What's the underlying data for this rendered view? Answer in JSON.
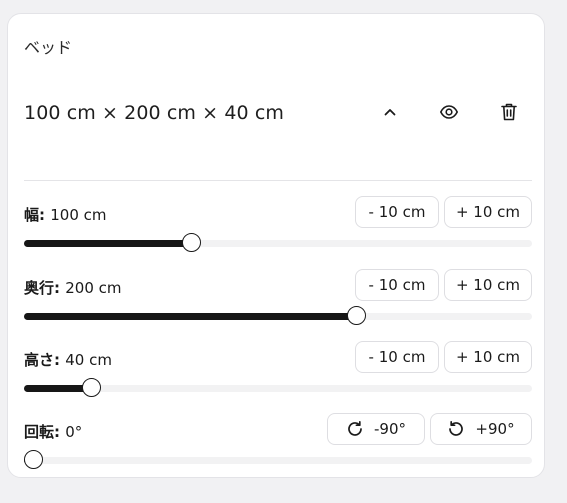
{
  "panel": {
    "title": "ベッド",
    "dimensions_text": "100 cm × 200 cm × 40 cm"
  },
  "header_icons": [
    "chevron-up-icon",
    "eye-icon",
    "trash-icon"
  ],
  "controls": {
    "width": {
      "label": "幅:",
      "value_text": "100 cm",
      "minus_label": "- 10 cm",
      "plus_label": "+ 10 cm",
      "slider_fraction": 0.33
    },
    "depth": {
      "label": "奥行:",
      "value_text": "200 cm",
      "minus_label": "- 10 cm",
      "plus_label": "+ 10 cm",
      "slider_fraction": 0.655
    },
    "height": {
      "label": "高さ:",
      "value_text": "40 cm",
      "minus_label": "- 10 cm",
      "plus_label": "+ 10 cm",
      "slider_fraction": 0.134
    },
    "rotation": {
      "label": "回転:",
      "value_text": "0°",
      "rotate_cw_label": "-90°",
      "rotate_ccw_label": "+90°",
      "slider_fraction": 0.02
    }
  },
  "colors": {
    "accent": "#161616",
    "track": "#f2f2f3",
    "background": "#f1f1f3"
  }
}
